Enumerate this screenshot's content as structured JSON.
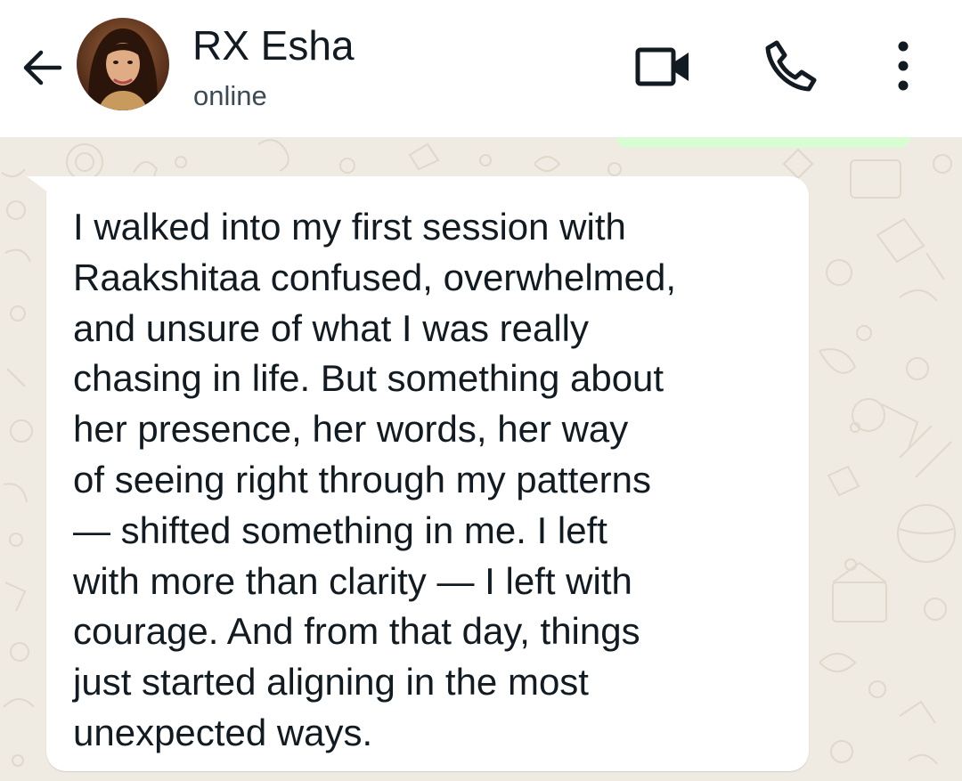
{
  "header": {
    "back_icon": "arrow-left-icon",
    "avatar_icon": "contact-photo",
    "contact_name": "RX Esha",
    "status": "online",
    "video_icon": "video-camera-icon",
    "call_icon": "phone-icon",
    "menu_icon": "more-vertical-icon"
  },
  "chat": {
    "message": "I walked into my first session with\nRaakshitaa confused, overwhelmed,\nand unsure of what I was really\nchasing in life. But something about\nher presence, her words, her way\nof seeing right through my patterns\n— shifted something in me. I left\nwith more than clarity — I left with\ncourage. And from that day, things\njust started aligning in the most\nunexpected ways."
  },
  "colors": {
    "header_bg": "#ffffff",
    "chat_bg": "#efeae2",
    "incoming_bubble": "#ffffff",
    "outgoing_bubble": "#d9fdd3",
    "text_primary": "#111b21",
    "text_secondary": "#3b4a54"
  }
}
